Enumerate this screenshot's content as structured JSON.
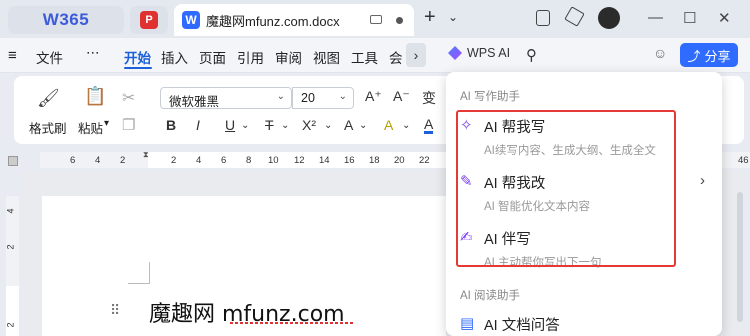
{
  "titlebar": {
    "brand": "W365",
    "pdf_badge": "P",
    "word_badge": "W",
    "doc_title": "魔趣网mfunz.com.docx",
    "new_tab": "+",
    "new_tab_caret": "⌄",
    "minimize": "—",
    "maximize": "☐",
    "close": "✕"
  },
  "menu": {
    "file": "文件",
    "more": "⋯",
    "items": [
      "开始",
      "插入",
      "页面",
      "引用",
      "审阅",
      "视图",
      "工具",
      "会"
    ],
    "wps_ai": "WPS AI",
    "share": "分享"
  },
  "ribbon": {
    "format_painter": "格式刷",
    "paste": "粘贴",
    "font_name": "微软雅黑",
    "font_size": "20",
    "bold": "B",
    "italic": "I",
    "underline": "U",
    "strike": "T",
    "superscript": "X²",
    "font_effects": "A",
    "highlight": "A",
    "font_color": "A",
    "grow_font": "A⁺",
    "shrink_font": "A⁻",
    "pinyin": "变"
  },
  "ruler": {
    "numbers": [
      "6",
      "4",
      "2",
      "2",
      "4",
      "6",
      "8",
      "10",
      "12",
      "14",
      "16",
      "18",
      "20",
      "22",
      "46"
    ],
    "vertical": [
      "4",
      "2",
      "2"
    ]
  },
  "document": {
    "heading": "魔趣网 mfunz.com",
    "drag": "⠿"
  },
  "ai_menu": {
    "section_write": "AI 写作助手",
    "items": [
      {
        "title": "AI 帮我写",
        "subtitle": "AI续写内容、生成大纲、生成全文"
      },
      {
        "title": "AI 帮我改",
        "subtitle": "AI 智能优化文本内容"
      },
      {
        "title": "AI 伴写",
        "subtitle": "AI 主动帮你写出下一句"
      }
    ],
    "section_read": "AI 阅读助手",
    "read_item": "AI 文档问答"
  },
  "colors": {
    "accent": "#2f6bff",
    "active_tab": "#1c5fd9",
    "ai_purple": "#7b3ff2",
    "highlight_box": "#e53935"
  }
}
